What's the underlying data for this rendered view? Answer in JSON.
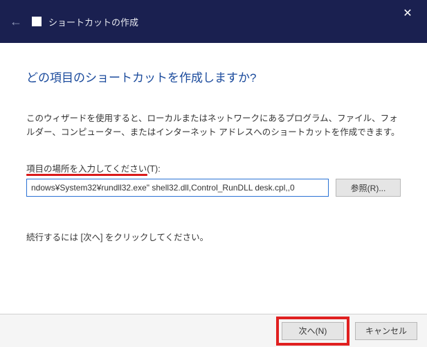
{
  "titlebar": {
    "back_icon": "←",
    "title": "ショートカットの作成",
    "close": "✕"
  },
  "main": {
    "heading": "どの項目のショートカットを作成しますか?",
    "description": "このウィザードを使用すると、ローカルまたはネットワークにあるプログラム、ファイル、フォルダー、コンピューター、またはインターネット アドレスへのショートカットを作成できます。",
    "input_label": "項目の場所を入力してください(T):",
    "location_value": "ndows¥System32¥rundll32.exe\" shell32.dll,Control_RunDLL desk.cpl,,0",
    "browse_label": "参照(R)...",
    "continue_text": "続行するには [次へ] をクリックしてください。"
  },
  "footer": {
    "next_label": "次へ(N)",
    "cancel_label": "キャンセル"
  }
}
